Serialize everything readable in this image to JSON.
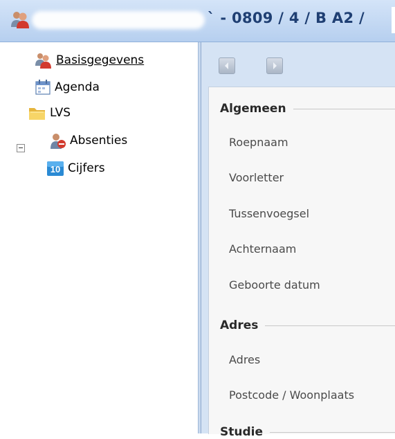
{
  "titlebar": {
    "title": "` - 0809 / 4 / B A2 /",
    "icon": "users-icon"
  },
  "sidebar": {
    "items": [
      {
        "label": "Basisgegevens",
        "icon": "users-icon",
        "selected": true
      },
      {
        "label": "Agenda",
        "icon": "calendar-icon"
      },
      {
        "label": "LVS",
        "icon": "folder-icon",
        "expanded": true
      },
      {
        "label": "Absenties",
        "icon": "person-absent-icon"
      },
      {
        "label": "Cijfers",
        "icon": "grade-10-icon",
        "badge": "10"
      }
    ]
  },
  "nav": {
    "back_icon": "back-arrow-icon",
    "forward_icon": "forward-arrow-icon"
  },
  "form": {
    "sections": [
      {
        "title": "Algemeen",
        "fields": [
          "Roepnaam",
          "Voorletter",
          "Tussenvoegsel",
          "Achternaam",
          "Geboorte datum"
        ]
      },
      {
        "title": "Adres",
        "fields": [
          "Adres",
          "Postcode / Woonplaats"
        ]
      },
      {
        "title": "Studie",
        "fields": []
      }
    ]
  },
  "colors": {
    "titlebar": "#c4d9f3",
    "panel_bg": "#d5e3f4",
    "form_bg": "#f7f7f7",
    "title_text": "#1f3f73"
  }
}
